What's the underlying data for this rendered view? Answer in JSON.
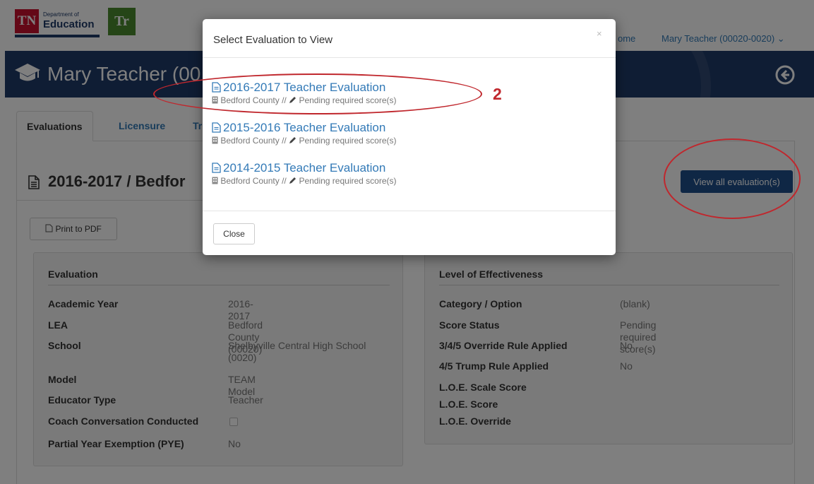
{
  "navbar": {
    "logo_tn_text": "TN",
    "logo_tn_dept": "Department of",
    "logo_tn_edu": "Education",
    "logo_tr_text": "Tr",
    "home_link": "ome",
    "user_menu": "Mary Teacher (00020-0020) ⌄"
  },
  "banner": {
    "title": "Mary Teacher (00",
    "background_color": "#1f3a68"
  },
  "tabs": [
    {
      "label": "Evaluations",
      "active": true
    },
    {
      "label": "Licensure",
      "active": false
    },
    {
      "label": "Tr",
      "active": false
    }
  ],
  "content": {
    "heading": "2016-2017 / Bedfor",
    "print_button": "Print to PDF",
    "view_all_button": "View all evaluation(s)"
  },
  "evaluation_panel": {
    "title": "Evaluation",
    "rows": [
      {
        "label": "Academic Year",
        "value": "2016-2017"
      },
      {
        "label": "LEA",
        "value": "Bedford County (00020)"
      },
      {
        "label": "School",
        "value": "Shelbyville Central High School (0020)"
      },
      {
        "label": "Model",
        "value": "TEAM Model"
      },
      {
        "label": "Educator Type",
        "value": "Teacher"
      },
      {
        "label": "Coach Conversation Conducted",
        "value": ""
      },
      {
        "label": "Partial Year Exemption (PYE)",
        "value": "No"
      }
    ]
  },
  "effectiveness_panel": {
    "title": "Level of Effectiveness",
    "rows": [
      {
        "label": "Category / Option",
        "value": "(blank)"
      },
      {
        "label": "Score Status",
        "value": "Pending required score(s)"
      },
      {
        "label": "3/4/5 Override Rule Applied",
        "value": "No"
      },
      {
        "label": "4/5 Trump Rule Applied",
        "value": "No"
      },
      {
        "label": "L.O.E. Scale Score",
        "value": ""
      },
      {
        "label": "L.O.E. Score",
        "value": ""
      },
      {
        "label": "L.O.E. Override",
        "value": ""
      }
    ]
  },
  "modal": {
    "title": "Select Evaluation to View",
    "close_x": "×",
    "evaluations": [
      {
        "title": "2016-2017 Teacher Evaluation",
        "lea": "Bedford County",
        "separator": "//",
        "status": "Pending required score(s)"
      },
      {
        "title": "2015-2016 Teacher Evaluation",
        "lea": "Bedford County",
        "separator": "//",
        "status": "Pending required score(s)"
      },
      {
        "title": "2014-2015 Teacher Evaluation",
        "lea": "Bedford County",
        "separator": "//",
        "status": "Pending required score(s)"
      }
    ],
    "close_button": "Close"
  },
  "annotation": {
    "step_number": "2",
    "color": "#c0272d"
  },
  "icons": {
    "document": "file-text-icon",
    "graduation": "graduation-cap-icon",
    "back": "circle-arrow-left-icon",
    "building": "building-icon",
    "pencil": "pencil-icon",
    "pdf": "pdf-file-icon"
  }
}
